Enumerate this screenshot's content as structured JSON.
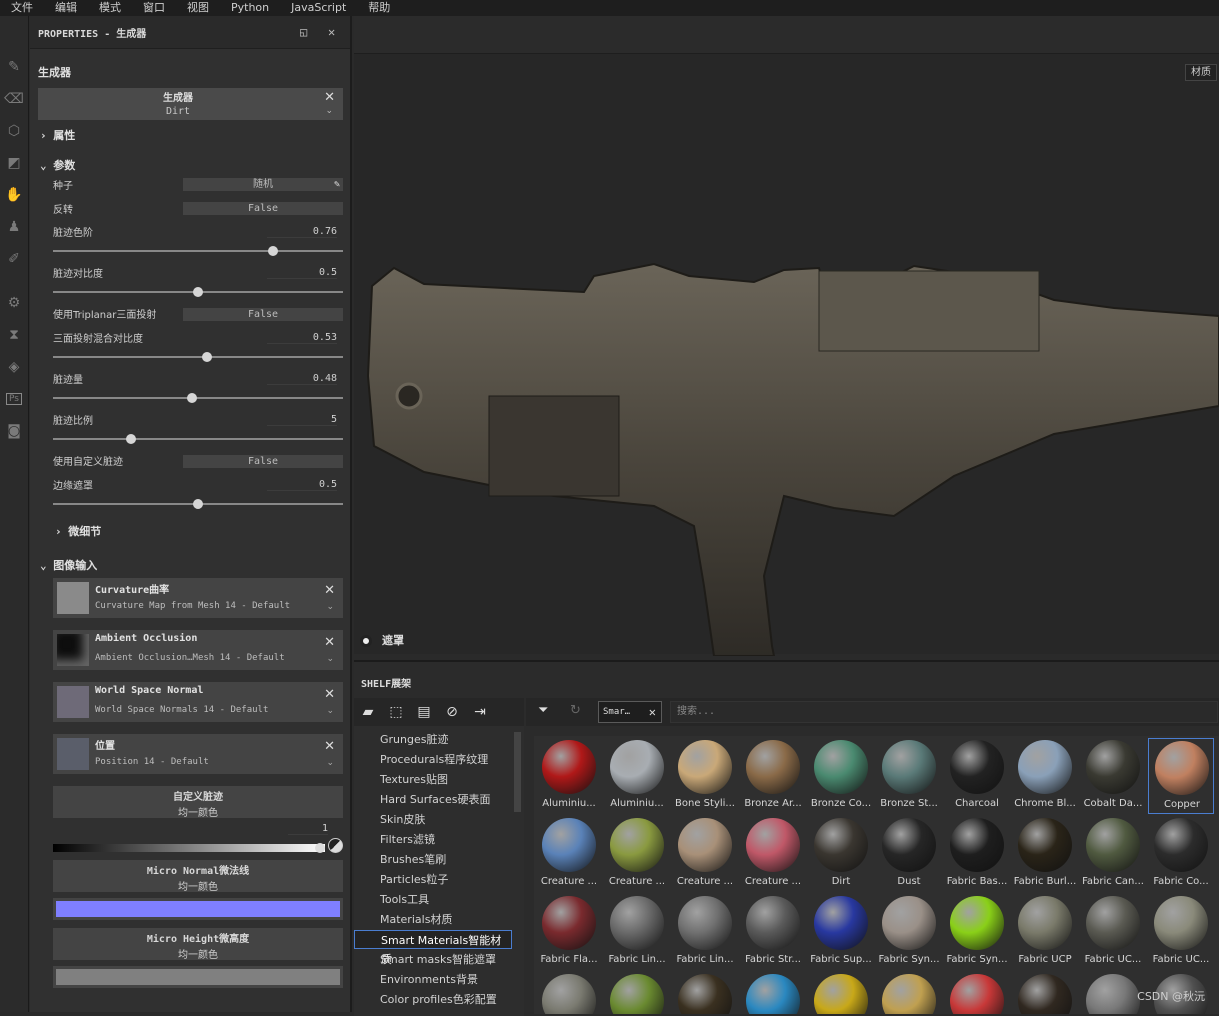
{
  "menu": [
    "文件",
    "编辑",
    "模式",
    "窗口",
    "视图",
    "Python",
    "JavaScript",
    "帮助"
  ],
  "toolbar": [
    "brush-icon",
    "eraser-icon",
    "projection-icon",
    "polygon-fill-icon",
    "smudge-icon",
    "clone-icon",
    "color-picker-icon",
    "settings-icon",
    "timer-icon",
    "layers-icon",
    "photoshop-icon",
    "render-icon"
  ],
  "properties": {
    "header": "PROPERTIES - 生成器",
    "section": "生成器",
    "gen_title": "生成器",
    "gen_value": "Dirt",
    "attr": "属性",
    "params": "参数",
    "seed_label": "种子",
    "seed_value": "随机",
    "invert_label": "反转",
    "invert_value": "False",
    "levels_label": "脏迹色阶",
    "levels_value": "0.76",
    "levels_frac": 0.76,
    "contrast_label": "脏迹对比度",
    "contrast_value": "0.5",
    "contrast_frac": 0.5,
    "triplanar_label": "使用Triplanar三面投射",
    "triplanar_value": "False",
    "blend_label": "三面投射混合对比度",
    "blend_value": "0.53",
    "blend_frac": 0.53,
    "amount_label": "脏迹量",
    "amount_value": "0.48",
    "amount_frac": 0.48,
    "scale_label": "脏迹比例",
    "scale_value": "5",
    "scale_frac": 0.27,
    "custom_label": "使用自定义脏迹",
    "custom_value": "False",
    "edge_label": "边缘遮罩",
    "edge_value": "0.5",
    "edge_frac": 0.5,
    "detail": "微细节",
    "inputs": "图像输入",
    "slots": [
      {
        "title": "Curvature曲率",
        "sub": "Curvature Map from Mesh 14 - Default"
      },
      {
        "title": "Ambient Occlusion",
        "sub": "Ambient Occlusion…Mesh 14 - Default"
      },
      {
        "title": "World Space Normal",
        "sub": "World Space Normals 14 - Default"
      },
      {
        "title": "位置",
        "sub": "Position 14 - Default"
      }
    ],
    "custom_dirt": "自定义脏迹",
    "custom_dirt_sub": "均一颜色",
    "grad_value": "1",
    "micro_normal": "Micro Normal微法线",
    "micro_normal_sub": "均一颜色",
    "micro_normal_color": "#7f7fff",
    "micro_height": "Micro Height微高度",
    "micro_height_sub": "均一颜色",
    "micro_height_color": "#808080"
  },
  "viewport": {
    "tag": "材质",
    "mask": "遮罩"
  },
  "shelf": {
    "title": "SHELF展架",
    "categories": [
      "Grunges脏迹",
      "Procedurals程序纹理",
      "Textures贴图",
      "Hard Surfaces硬表面",
      "Skin皮肤",
      "Filters滤镜",
      "Brushes笔刷",
      "Particles粒子",
      "Tools工具",
      "Materials材质",
      "Smart Materials智能材质",
      "Smart masks智能遮罩",
      "Environments背景",
      "Color profiles色彩配置"
    ],
    "filter_tag": "Smar…",
    "search_placeholder": "搜索...",
    "materials": [
      {
        "name": "Aluminiu...",
        "color": "#b01818"
      },
      {
        "name": "Aluminiu...",
        "color": "#a8adb2"
      },
      {
        "name": "Bone Styli...",
        "color": "#c9a878"
      },
      {
        "name": "Bronze Ar...",
        "color": "#8a6a48"
      },
      {
        "name": "Bronze Co...",
        "color": "#4a8a70"
      },
      {
        "name": "Bronze St...",
        "color": "#5a7a78"
      },
      {
        "name": "Charcoal",
        "color": "#222222"
      },
      {
        "name": "Chrome Bl...",
        "color": "#8aa0b8"
      },
      {
        "name": "Cobalt Da...",
        "color": "#3a3a32"
      },
      {
        "name": "Copper",
        "color": "#c08060"
      },
      {
        "name": "Creature ...",
        "color": "#5a82b8"
      },
      {
        "name": "Creature ...",
        "color": "#8a9a40"
      },
      {
        "name": "Creature ...",
        "color": "#a89078"
      },
      {
        "name": "Creature ...",
        "color": "#c05868"
      },
      {
        "name": "Dirt",
        "color": "#3a3630"
      },
      {
        "name": "Dust",
        "color": "#262626"
      },
      {
        "name": "Fabric Bas...",
        "color": "#1e1e1e"
      },
      {
        "name": "Fabric Burl...",
        "color": "#2a2418"
      },
      {
        "name": "Fabric Can...",
        "color": "#505a40"
      },
      {
        "name": "Fabric Co...",
        "color": "#2c2c2c"
      },
      {
        "name": "Fabric Fla...",
        "color": "#7a2a2e"
      },
      {
        "name": "Fabric Lin...",
        "color": "#6a6a6a"
      },
      {
        "name": "Fabric Lin...",
        "color": "#707070"
      },
      {
        "name": "Fabric Str...",
        "color": "#5a5a5a"
      },
      {
        "name": "Fabric Sup...",
        "color": "#2838a0"
      },
      {
        "name": "Fabric Syn...",
        "color": "#9a9088"
      },
      {
        "name": "Fabric Syn...",
        "color": "#8ad018"
      },
      {
        "name": "Fabric UCP",
        "color": "#7a7a6a"
      },
      {
        "name": "Fabric UC...",
        "color": "#5a5a52"
      },
      {
        "name": "Fabric UC...",
        "color": "#8a8a7a"
      },
      {
        "name": "",
        "color": "#7a7a70"
      },
      {
        "name": "",
        "color": "#6a8a30"
      },
      {
        "name": "",
        "color": "#3a3020"
      },
      {
        "name": "",
        "color": "#2a88c0"
      },
      {
        "name": "",
        "color": "#c8a818"
      },
      {
        "name": "",
        "color": "#c0a050"
      },
      {
        "name": "",
        "color": "#c83838"
      },
      {
        "name": "",
        "color": "#302820"
      },
      {
        "name": "",
        "color": "#787878"
      },
      {
        "name": "",
        "color": "#505050"
      }
    ],
    "watermark": "CSDN @秋沅"
  }
}
